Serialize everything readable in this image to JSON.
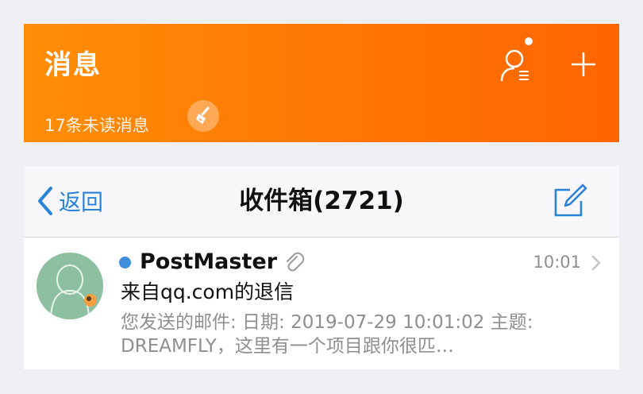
{
  "header": {
    "title": "消息",
    "unread_summary": "17条未读消息",
    "icons": {
      "clean": "broom-icon",
      "contacts": "contacts-icon",
      "add": "plus-icon"
    },
    "accent_color": "#ff7a05"
  },
  "nav": {
    "back_label": "返回",
    "title": "收件箱(2721)",
    "accent_color": "#2b82d9"
  },
  "messages": [
    {
      "sender": "PostMaster",
      "time": "10:01",
      "subject": "来自qq.com的退信",
      "preview": "您发送的邮件: 日期: 2019-07-29 10:01:02 主题: DREAMFLY，这里有一个项目跟你很匹…",
      "unread": true,
      "has_attachment": true
    }
  ]
}
